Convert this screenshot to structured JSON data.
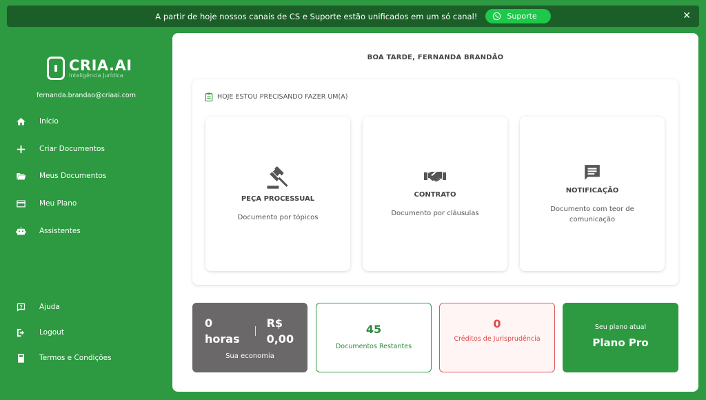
{
  "banner": {
    "message": "A partir de hoje nossos canais de CS e Suporte estão unificados em um só canal!",
    "support_label": "Suporte",
    "close_glyph": "✕"
  },
  "brand": {
    "name": "CRIA.AI",
    "tagline": "Inteligência Jurídica"
  },
  "user": {
    "email": "fernanda.brandao@criaai.com"
  },
  "sidebar": {
    "items": [
      {
        "label": "Início",
        "icon": "home-icon"
      },
      {
        "label": "Criar Documentos",
        "icon": "plus-icon"
      },
      {
        "label": "Meus Documentos",
        "icon": "folder-icon"
      },
      {
        "label": "Meu Plano",
        "icon": "credit-card-icon"
      },
      {
        "label": "Assistentes",
        "icon": "robot-icon"
      }
    ],
    "footer_items": [
      {
        "label": "Ajuda",
        "icon": "help-icon"
      },
      {
        "label": "Logout",
        "icon": "logout-icon"
      },
      {
        "label": "Termos e Condições",
        "icon": "book-icon"
      }
    ]
  },
  "main": {
    "greeting": "BOA TARDE, FERNANDA BRANDÃO",
    "need_title": "HOJE ESTOU PRECISANDO FAZER UM(A)",
    "cards": [
      {
        "title": "PEÇA PROCESSUAL",
        "description": "Documento por tópicos",
        "icon": "gavel-icon"
      },
      {
        "title": "CONTRATO",
        "description": "Documento por cláusulas",
        "icon": "handshake-icon"
      },
      {
        "title": "NOTIFICAÇÃO",
        "description": "Documento com teor de comunicação",
        "icon": "message-icon"
      }
    ],
    "stats": {
      "hours_value": "0",
      "hours_unit": "horas",
      "currency": "R$",
      "money_value": "0,00",
      "savings_label": "Sua economia",
      "docs_value": "45",
      "docs_label": "Documentos Restantes",
      "credits_value": "0",
      "credits_label": "Créditos de Jurisprudência",
      "plan_caption": "Seu plano atual",
      "plan_name": "Plano Pro"
    }
  },
  "colors": {
    "brand_green": "#2d9940",
    "banner_dark": "#1b5e28",
    "whatsapp_green": "#1ec84a",
    "savings_gray": "#6b6869",
    "credits_red": "#e04848"
  }
}
